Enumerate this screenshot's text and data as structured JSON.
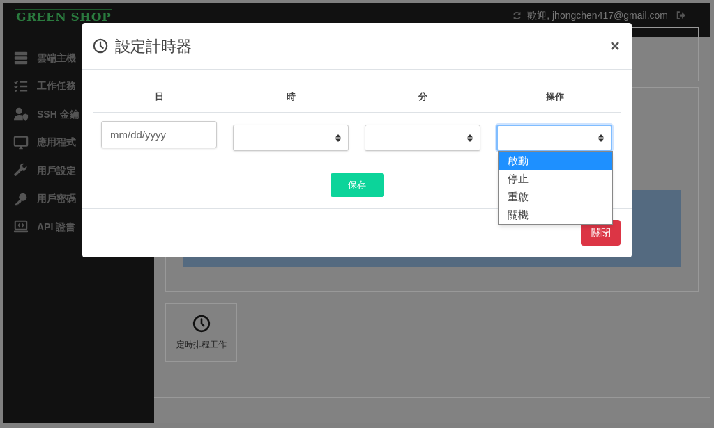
{
  "brand": "GREEN SHOP",
  "header": {
    "welcome": "歡迎, jhongchen417@gmail.com"
  },
  "sidebar": {
    "items": [
      {
        "label": "雲端主機"
      },
      {
        "label": "工作任務"
      },
      {
        "label": "SSH 金鑰"
      },
      {
        "label": "應用程式"
      },
      {
        "label": "用戶設定"
      },
      {
        "label": "用戶密碼"
      },
      {
        "label": "API 證書"
      }
    ]
  },
  "tiles": [
    {
      "label": "定時排程工作"
    }
  ],
  "modal": {
    "title": "設定計時器",
    "columns": [
      "日",
      "時",
      "分",
      "操作"
    ],
    "date_placeholder": "mm/dd/yyyy",
    "selects": [
      {
        "focused": false
      },
      {
        "focused": false
      },
      {
        "focused": true
      }
    ],
    "dropdown": [
      {
        "label": "啟動",
        "selected": true
      },
      {
        "label": "停止",
        "selected": false
      },
      {
        "label": "重啟",
        "selected": false
      },
      {
        "label": "關機",
        "selected": false
      }
    ],
    "save": "保存",
    "close": "關閉"
  }
}
